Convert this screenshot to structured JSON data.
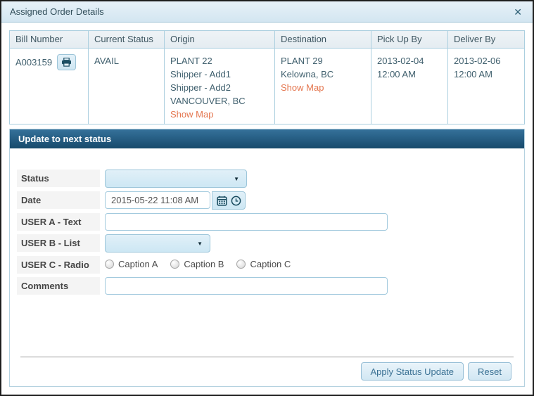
{
  "dialog": {
    "title": "Assigned Order Details"
  },
  "icons": {
    "close": "✕",
    "dropdown_arrow": "▼",
    "printer": "printer-icon",
    "calendar": "calendar-icon",
    "clock": "clock-icon"
  },
  "colors": {
    "panel_header_top": "#35719a",
    "panel_header_bottom": "#174a6c",
    "table_border": "#abcfdf",
    "link": "#e4764f",
    "button_text": "#3a7194",
    "titlebar_bg": "#d9e8f2"
  },
  "order_table": {
    "headers": [
      "Bill Number",
      "Current Status",
      "Origin",
      "Destination",
      "Pick Up By",
      "Deliver By"
    ],
    "row": {
      "bill_number": "A003159",
      "current_status": "AVAIL",
      "origin_lines": [
        "PLANT 22",
        "Shipper - Add1",
        "Shipper - Add2",
        "VANCOUVER, BC"
      ],
      "origin_link": "Show Map",
      "destination_lines": [
        "PLANT 29",
        "Kelowna, BC"
      ],
      "destination_link": "Show Map",
      "pickup_lines": [
        "2013-02-04",
        "12:00 AM"
      ],
      "deliver_lines": [
        "2013-02-06",
        "12:00 AM"
      ]
    }
  },
  "form": {
    "section_title": "Update to next status",
    "fields": {
      "status_label": "Status",
      "status_value": "",
      "date_label": "Date",
      "date_value": "2015-05-22 11:08 AM",
      "user_a_label": "USER A - Text",
      "user_a_value": "",
      "user_b_label": "USER B - List",
      "user_b_value": "",
      "user_c_label": "USER C - Radio",
      "radio_options": [
        "Caption A",
        "Caption B",
        "Caption C"
      ],
      "comments_label": "Comments",
      "comments_value": ""
    },
    "buttons": {
      "apply": "Apply Status Update",
      "reset": "Reset"
    }
  }
}
